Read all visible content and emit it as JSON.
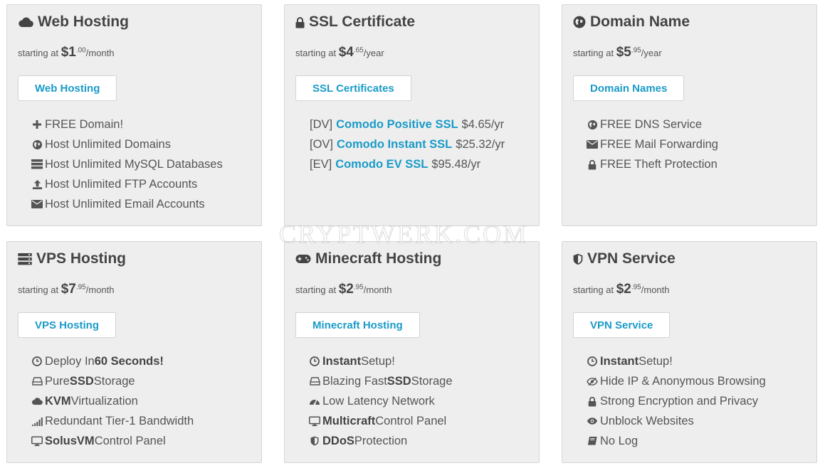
{
  "price_prefix": "starting at ",
  "watermark": "CRYPTWERK.COM",
  "cards": [
    {
      "title": "Web Hosting",
      "icon": "cloud-icon",
      "price": {
        "amount": "$1",
        "cents": ".00",
        "period": "/month"
      },
      "button": "Web Hosting",
      "features": [
        {
          "icon": "plus-icon",
          "text": "FREE Domain!"
        },
        {
          "icon": "globe-icon",
          "text": "Host Unlimited Domains"
        },
        {
          "icon": "server-icon",
          "text": "Host Unlimited MySQL Databases"
        },
        {
          "icon": "upload-icon",
          "text": "Host Unlimited FTP Accounts"
        },
        {
          "icon": "envelope-icon",
          "text": "Host Unlimited Email Accounts"
        }
      ]
    },
    {
      "title": "SSL Certificate",
      "icon": "lock-icon",
      "price": {
        "amount": "$4",
        "cents": ".65",
        "period": "/year"
      },
      "button": "SSL Certificates",
      "ssl": [
        {
          "prefix": "[DV]",
          "name": "Comodo Positive SSL",
          "price": "$4.65/yr"
        },
        {
          "prefix": "[OV]",
          "name": "Comodo Instant SSL",
          "price": "$25.32/yr"
        },
        {
          "prefix": "[EV]",
          "name": "Comodo EV SSL",
          "price": "$95.48/yr"
        }
      ]
    },
    {
      "title": "Domain Name",
      "icon": "globe-icon",
      "price": {
        "amount": "$5",
        "cents": ".95",
        "period": "/year"
      },
      "button": "Domain Names",
      "features": [
        {
          "icon": "globe-icon",
          "text": "FREE DNS Service"
        },
        {
          "icon": "envelope-icon",
          "text": "FREE Mail Forwarding"
        },
        {
          "icon": "lock-icon",
          "text": "FREE Theft Protection"
        }
      ]
    },
    {
      "title": "VPS Hosting",
      "icon": "server-icon",
      "price": {
        "amount": "$7",
        "cents": ".95",
        "period": "/month"
      },
      "button": "VPS Hosting",
      "features": [
        {
          "icon": "clock-icon",
          "pre": "Deploy In ",
          "bold": "60 Seconds!",
          "post": ""
        },
        {
          "icon": "hdd-icon",
          "pre": "Pure ",
          "bold": "SSD",
          "post": " Storage"
        },
        {
          "icon": "cloud-icon",
          "pre": "",
          "bold": "KVM",
          "post": " Virtualization"
        },
        {
          "icon": "signal-icon",
          "pre": "Redundant Tier-1 Bandwidth",
          "bold": "",
          "post": ""
        },
        {
          "icon": "desktop-icon",
          "pre": "",
          "bold": "SolusVM",
          "post": " Control Panel"
        }
      ]
    },
    {
      "title": "Minecraft Hosting",
      "icon": "gamepad-icon",
      "price": {
        "amount": "$2",
        "cents": ".95",
        "period": "/month"
      },
      "button": "Minecraft Hosting",
      "features": [
        {
          "icon": "clock-icon",
          "pre": "",
          "bold": "Instant",
          "post": " Setup!"
        },
        {
          "icon": "hdd-icon",
          "pre": "Blazing Fast ",
          "bold": "SSD",
          "post": " Storage"
        },
        {
          "icon": "dashboard-icon",
          "pre": "Low Latency Network",
          "bold": "",
          "post": ""
        },
        {
          "icon": "desktop-icon",
          "pre": "",
          "bold": "Multicraft",
          "post": " Control Panel"
        },
        {
          "icon": "shield-icon",
          "pre": "",
          "bold": "DDoS",
          "post": " Protection"
        }
      ]
    },
    {
      "title": "VPN Service",
      "icon": "shield-icon",
      "price": {
        "amount": "$2",
        "cents": ".95",
        "period": "/month"
      },
      "button": "VPN Service",
      "features": [
        {
          "icon": "clock-icon",
          "pre": "",
          "bold": "Instant",
          "post": " Setup!"
        },
        {
          "icon": "eye-slash-icon",
          "pre": "Hide IP & Anonymous Browsing",
          "bold": "",
          "post": ""
        },
        {
          "icon": "lock-icon",
          "pre": "Strong Encryption and Privacy",
          "bold": "",
          "post": ""
        },
        {
          "icon": "eye-icon",
          "pre": "Unblock Websites",
          "bold": "",
          "post": ""
        },
        {
          "icon": "book-icon",
          "pre": "No Log",
          "bold": "",
          "post": ""
        }
      ]
    }
  ]
}
